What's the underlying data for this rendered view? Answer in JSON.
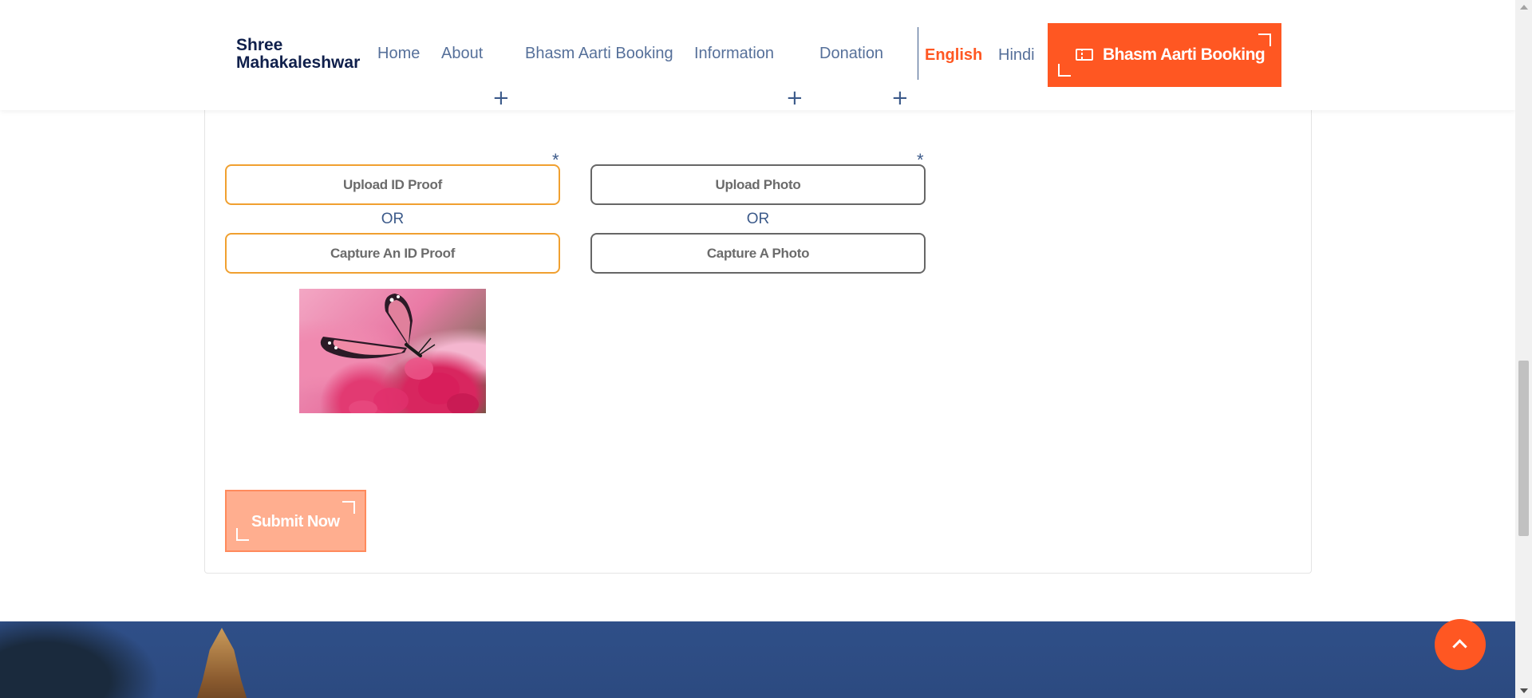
{
  "header": {
    "logo_line1": "Shree",
    "logo_line2": "Mahakaleshwar",
    "nav": {
      "home": "Home",
      "about": "About",
      "bhasm_aarti_booking": "Bhasm Aarti Booking",
      "information": "Information",
      "donation": "Donation"
    },
    "plus_glyph": "+",
    "languages": {
      "english": "English",
      "hindi": "Hindi",
      "active": "English"
    },
    "cta_label": "Bhasm Aarti Booking"
  },
  "form": {
    "required_mark": "*",
    "id_proof": {
      "upload_label": "Upload ID Proof",
      "or_label": "OR",
      "capture_label": "Capture An ID Proof"
    },
    "photo": {
      "upload_label": "Upload Photo",
      "or_label": "OR",
      "capture_label": "Capture A Photo"
    },
    "submit_label": "Submit Now"
  },
  "icons": {
    "nav_expand": "plus-icon",
    "cta": "ticket-icon",
    "scroll_top": "chevron-up-icon"
  },
  "colors": {
    "accent": "#ff5722",
    "nav_text": "#56709a",
    "logo": "#0f1f4b",
    "id_button_border": "#f0a030",
    "photo_button_border": "#666666",
    "submit_disabled_bg": "#ffae8f",
    "footer_bg": "#2f4f88"
  }
}
